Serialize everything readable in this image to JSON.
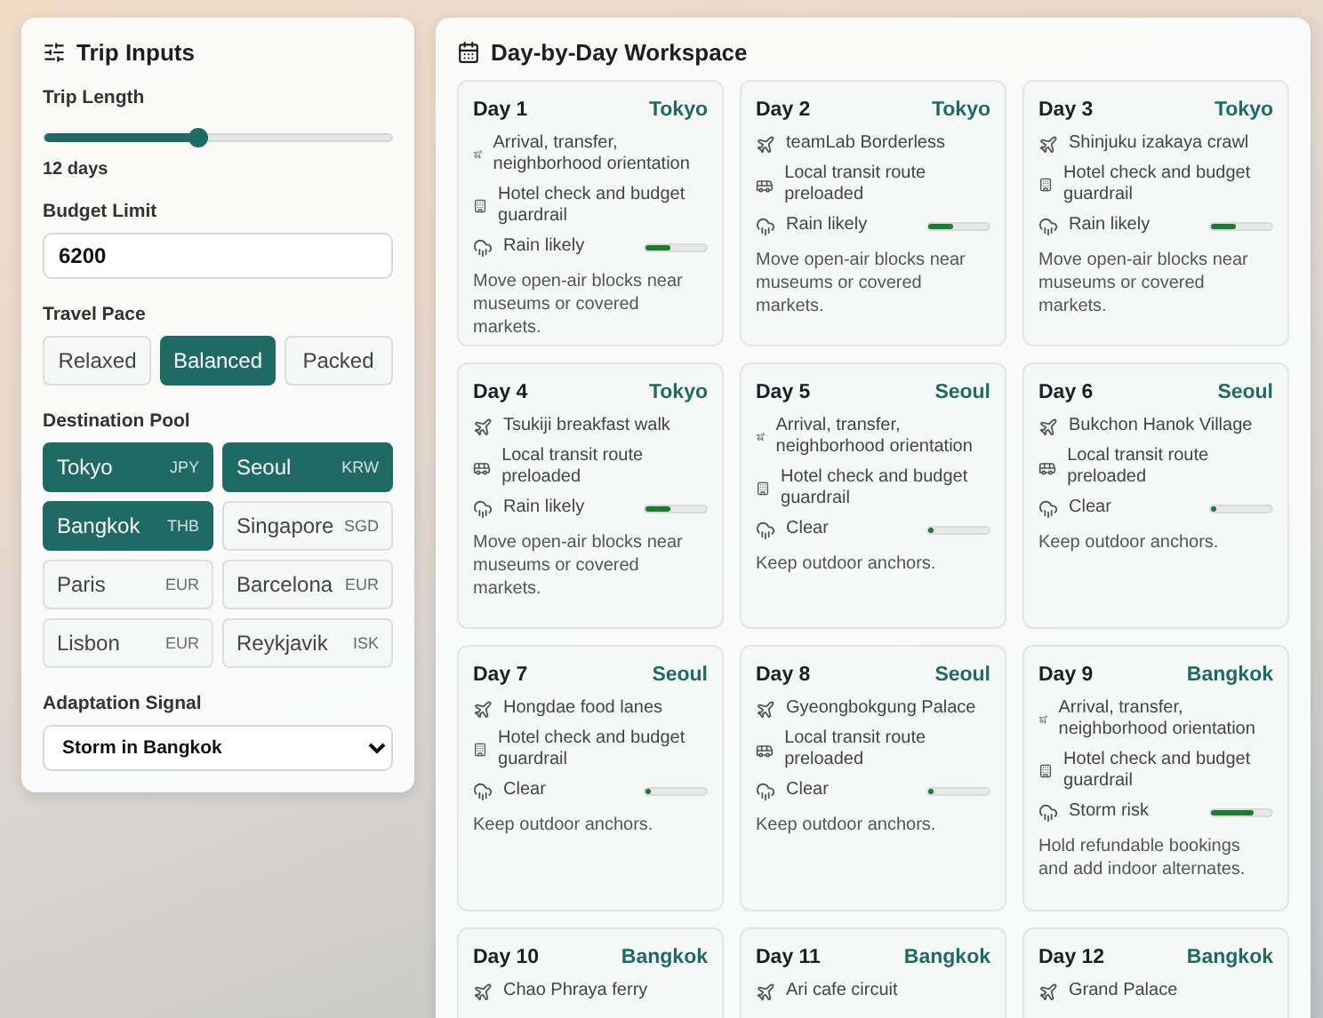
{
  "trip_inputs": {
    "title": "Trip Inputs",
    "trip_length": {
      "label": "Trip Length",
      "level": 0.44,
      "reading": "12 days"
    },
    "budget": {
      "label": "Budget Limit",
      "value": "6200"
    },
    "pace": {
      "label": "Travel Pace",
      "options": [
        {
          "label": "Relaxed",
          "selected": false
        },
        {
          "label": "Balanced",
          "selected": true
        },
        {
          "label": "Packed",
          "selected": false
        }
      ]
    },
    "destinations": {
      "label": "Destination Pool",
      "items": [
        {
          "city": "Tokyo",
          "currency": "JPY",
          "selected": true
        },
        {
          "city": "Seoul",
          "currency": "KRW",
          "selected": true
        },
        {
          "city": "Bangkok",
          "currency": "THB",
          "selected": true
        },
        {
          "city": "Singapore",
          "currency": "SGD",
          "selected": false
        },
        {
          "city": "Paris",
          "currency": "EUR",
          "selected": false
        },
        {
          "city": "Barcelona",
          "currency": "EUR",
          "selected": false
        },
        {
          "city": "Lisbon",
          "currency": "EUR",
          "selected": false
        },
        {
          "city": "Reykjavik",
          "currency": "ISK",
          "selected": false
        }
      ]
    },
    "signal": {
      "label": "Adaptation Signal",
      "value": "Storm in Bangkok"
    }
  },
  "workspace": {
    "title": "Day-by-Day Workspace",
    "days": [
      {
        "day": "Day 1",
        "city": "Tokyo",
        "items": [
          {
            "kind": "arrival",
            "text": "Arrival, transfer, neighborhood orientation"
          },
          {
            "kind": "hotel",
            "text": "Hotel check and budget guardrail"
          }
        ],
        "weather": {
          "text": "Rain likely",
          "level": 0.42
        },
        "note": "Move open-air blocks near museums or covered markets."
      },
      {
        "day": "Day 2",
        "city": "Tokyo",
        "items": [
          {
            "kind": "activity",
            "text": "teamLab Borderless"
          },
          {
            "kind": "transit",
            "text": "Local transit route preloaded"
          }
        ],
        "weather": {
          "text": "Rain likely",
          "level": 0.42
        },
        "note": "Move open-air blocks near museums or covered markets."
      },
      {
        "day": "Day 3",
        "city": "Tokyo",
        "items": [
          {
            "kind": "activity",
            "text": "Shinjuku izakaya crawl"
          },
          {
            "kind": "hotel",
            "text": "Hotel check and budget guardrail"
          }
        ],
        "weather": {
          "text": "Rain likely",
          "level": 0.42
        },
        "note": "Move open-air blocks near museums or covered markets."
      },
      {
        "day": "Day 4",
        "city": "Tokyo",
        "items": [
          {
            "kind": "activity",
            "text": "Tsukiji breakfast walk"
          },
          {
            "kind": "transit",
            "text": "Local transit route preloaded"
          }
        ],
        "weather": {
          "text": "Rain likely",
          "level": 0.42
        },
        "note": "Move open-air blocks near museums or covered markets."
      },
      {
        "day": "Day 5",
        "city": "Seoul",
        "items": [
          {
            "kind": "arrival",
            "text": "Arrival, transfer, neighborhood orientation"
          },
          {
            "kind": "hotel",
            "text": "Hotel check and budget guardrail"
          }
        ],
        "weather": {
          "text": "Clear",
          "level": 0.08
        },
        "note": "Keep outdoor anchors."
      },
      {
        "day": "Day 6",
        "city": "Seoul",
        "items": [
          {
            "kind": "activity",
            "text": "Bukchon Hanok Village"
          },
          {
            "kind": "transit",
            "text": "Local transit route preloaded"
          }
        ],
        "weather": {
          "text": "Clear",
          "level": 0.08
        },
        "note": "Keep outdoor anchors."
      },
      {
        "day": "Day 7",
        "city": "Seoul",
        "items": [
          {
            "kind": "activity",
            "text": "Hongdae food lanes"
          },
          {
            "kind": "hotel",
            "text": "Hotel check and budget guardrail"
          }
        ],
        "weather": {
          "text": "Clear",
          "level": 0.08
        },
        "note": "Keep outdoor anchors."
      },
      {
        "day": "Day 8",
        "city": "Seoul",
        "items": [
          {
            "kind": "activity",
            "text": "Gyeongbokgung Palace"
          },
          {
            "kind": "transit",
            "text": "Local transit route preloaded"
          }
        ],
        "weather": {
          "text": "Clear",
          "level": 0.08
        },
        "note": "Keep outdoor anchors."
      },
      {
        "day": "Day 9",
        "city": "Bangkok",
        "items": [
          {
            "kind": "arrival",
            "text": "Arrival, transfer, neighborhood orientation"
          },
          {
            "kind": "hotel",
            "text": "Hotel check and budget guardrail"
          }
        ],
        "weather": {
          "text": "Storm risk",
          "level": 0.7
        },
        "note": "Hold refundable bookings and add indoor alternates."
      },
      {
        "day": "Day 10",
        "city": "Bangkok",
        "items": [
          {
            "kind": "activity",
            "text": "Chao Phraya ferry"
          }
        ]
      },
      {
        "day": "Day 11",
        "city": "Bangkok",
        "items": [
          {
            "kind": "activity",
            "text": "Ari cafe circuit"
          }
        ]
      },
      {
        "day": "Day 12",
        "city": "Bangkok",
        "items": [
          {
            "kind": "activity",
            "text": "Grand Palace"
          }
        ]
      }
    ]
  }
}
